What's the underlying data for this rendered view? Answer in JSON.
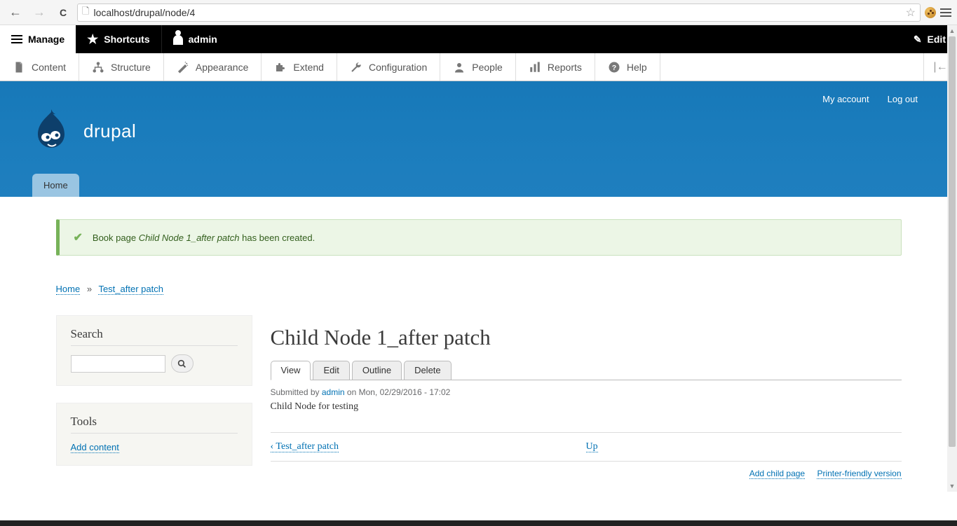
{
  "browser": {
    "url": "localhost/drupal/node/4"
  },
  "admin_bar": {
    "manage": "Manage",
    "shortcuts": "Shortcuts",
    "admin": "admin",
    "edit": "Edit"
  },
  "admin_sub": [
    {
      "label": "Content",
      "icon": "file"
    },
    {
      "label": "Structure",
      "icon": "hierarchy"
    },
    {
      "label": "Appearance",
      "icon": "wand"
    },
    {
      "label": "Extend",
      "icon": "puzzle"
    },
    {
      "label": "Configuration",
      "icon": "wrench"
    },
    {
      "label": "People",
      "icon": "person"
    },
    {
      "label": "Reports",
      "icon": "bars"
    },
    {
      "label": "Help",
      "icon": "question"
    }
  ],
  "header": {
    "site_name": "drupal",
    "user_menu": {
      "account": "My account",
      "logout": "Log out"
    },
    "home": "Home"
  },
  "status": {
    "prefix": "Book page ",
    "title": "Child Node 1_after patch",
    "suffix": " has been created."
  },
  "breadcrumb": {
    "home": "Home",
    "test": "Test_after patch"
  },
  "sidebar": {
    "search_title": "Search",
    "search_value": "",
    "tools_title": "Tools",
    "add_content": "Add content"
  },
  "main": {
    "title": "Child Node 1_after patch",
    "tabs": {
      "view": "View",
      "edit": "Edit",
      "outline": "Outline",
      "delete": "Delete"
    },
    "submitted_prefix": "Submitted by ",
    "submitted_author": "admin",
    "submitted_date": " on Mon, 02/29/2016 - 17:02",
    "body": "Child Node for testing",
    "nav_prev": "‹ Test_after patch",
    "nav_up": "Up",
    "links": {
      "add_child": "Add child page",
      "printer": "Printer-friendly version"
    }
  }
}
